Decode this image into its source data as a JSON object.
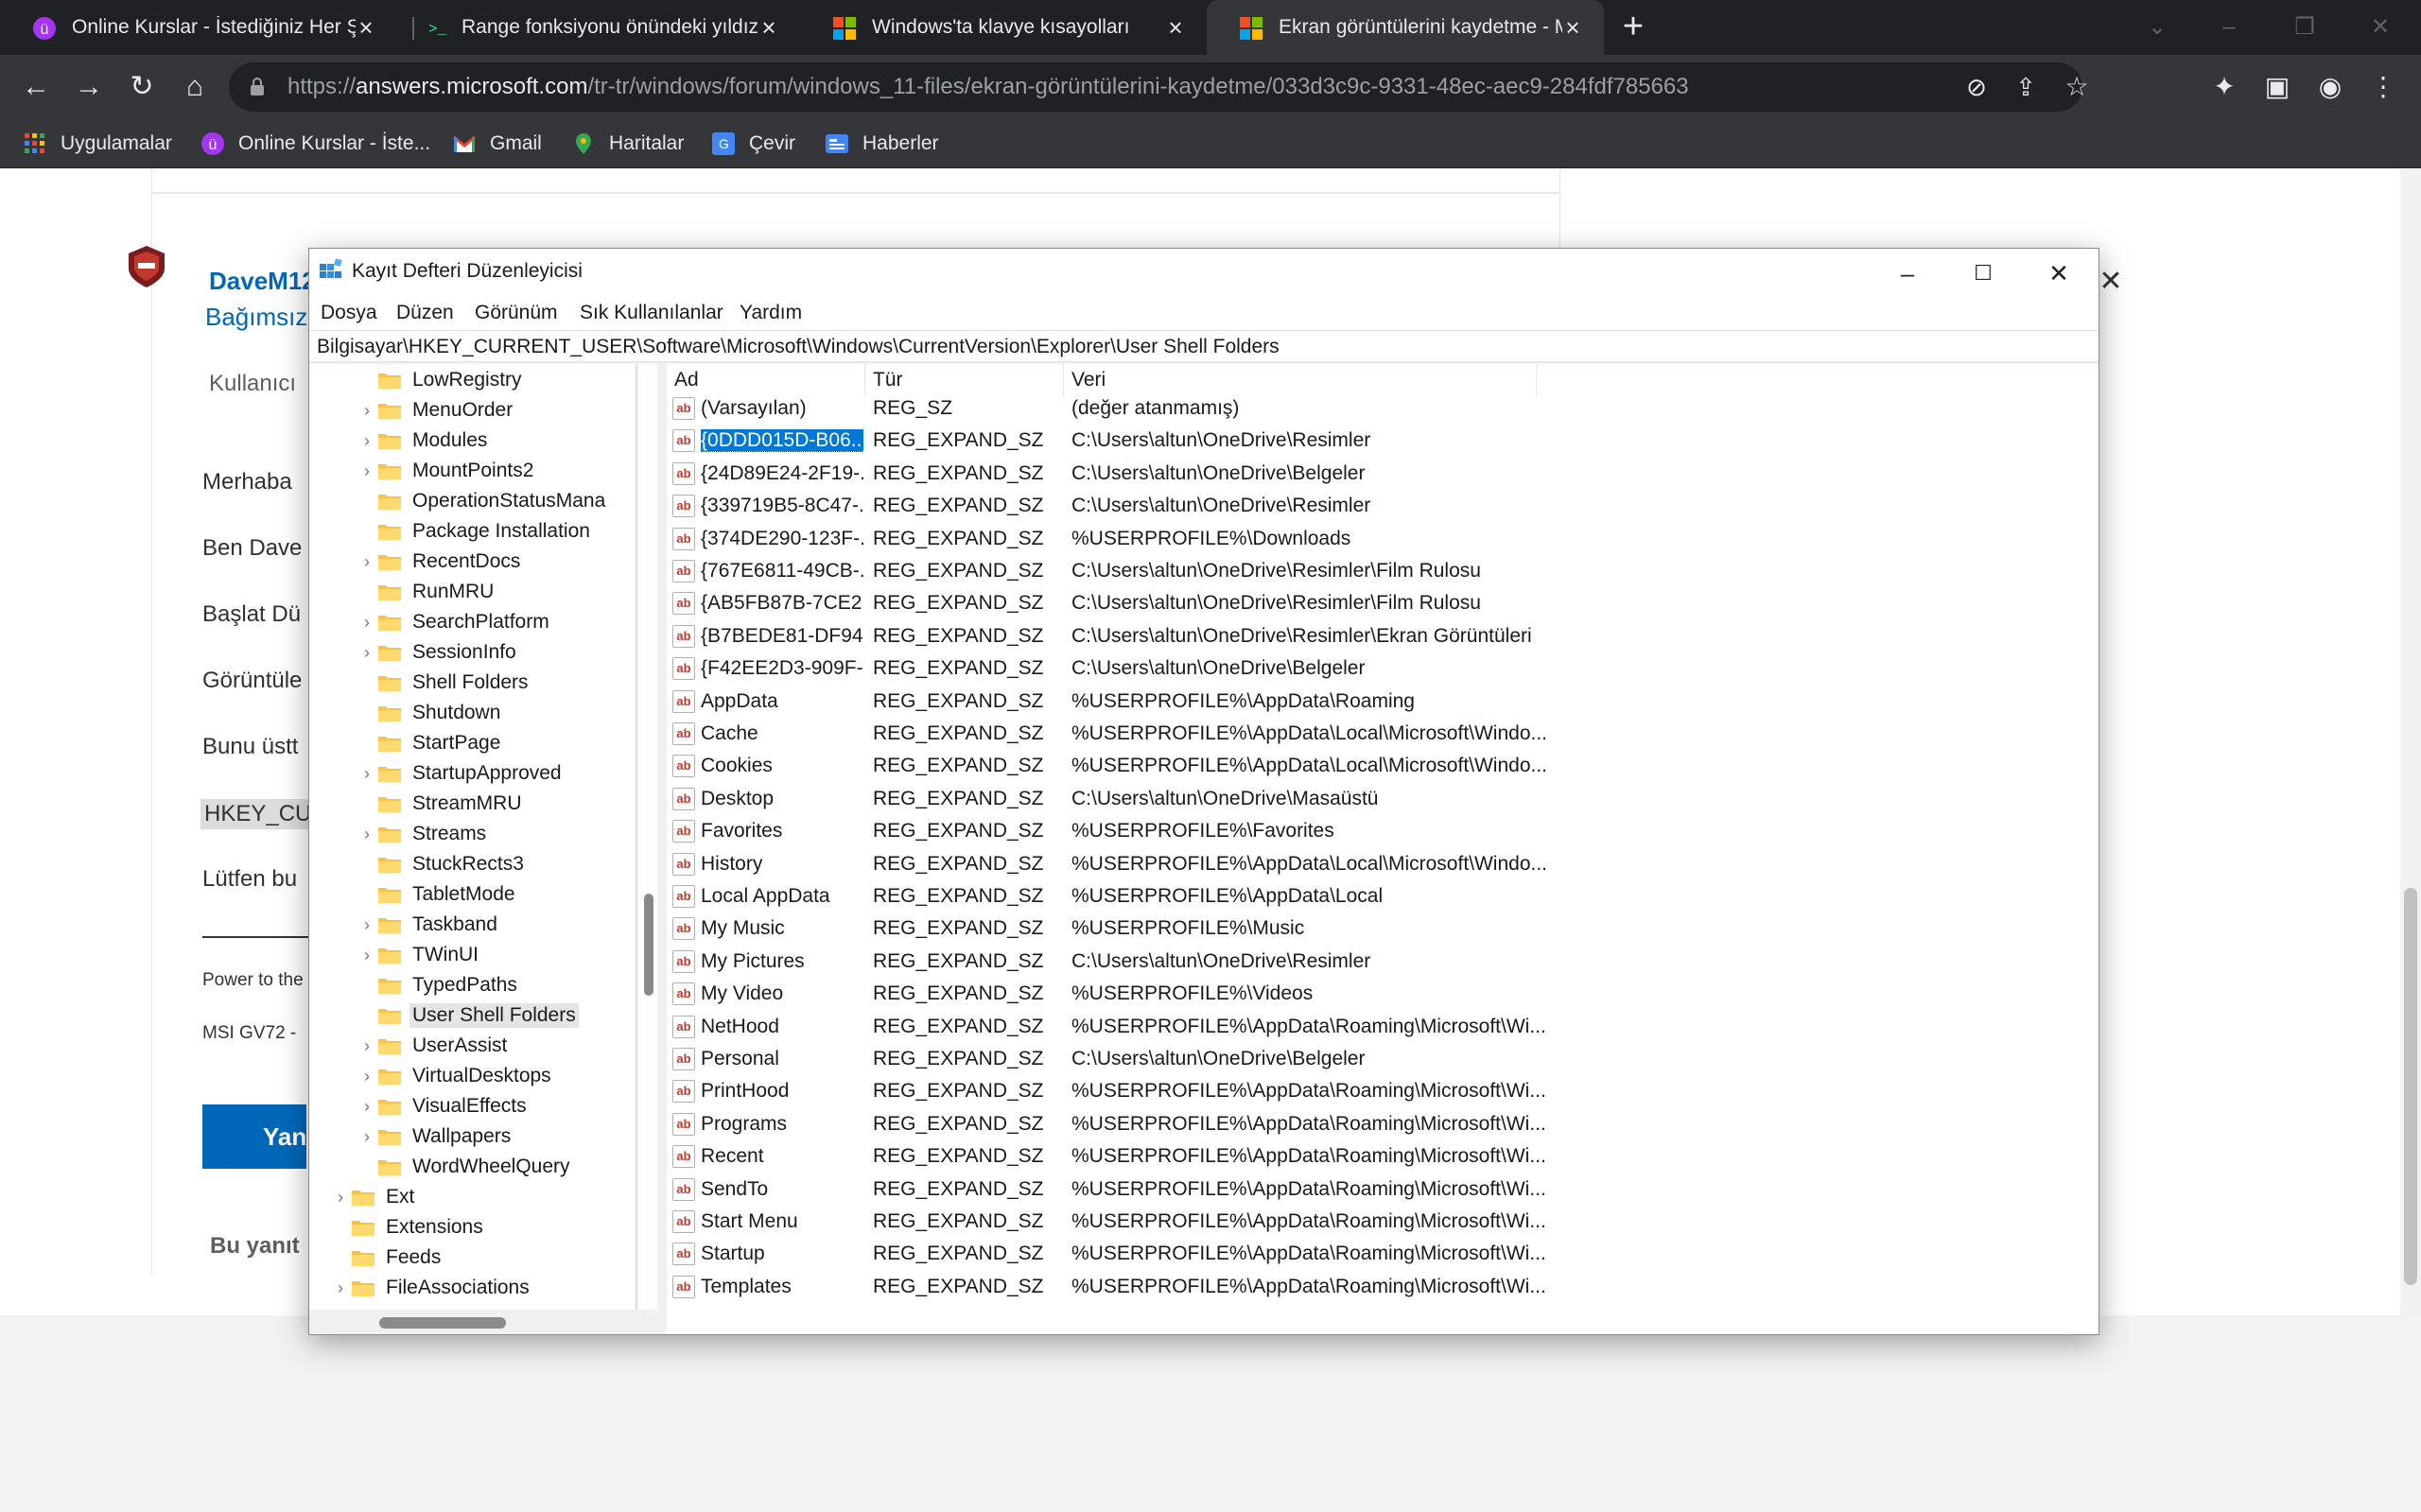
{
  "browser": {
    "tabs": [
      {
        "label": "Online Kurslar - İstediğiniz Her Şey",
        "active": false
      },
      {
        "label": "Range fonksiyonu önündeki yıldız",
        "active": false
      },
      {
        "label": "Windows'ta klavye kısayolları",
        "active": false
      },
      {
        "label": "Ekran görüntülerini kaydetme - M",
        "active": true
      }
    ],
    "new_tab": "+",
    "url_prefix": "https://",
    "url_host": "answers.microsoft.com",
    "url_path": "/tr-tr/windows/forum/windows_11-files/ekran-görüntülerini-kaydetme/033d3c9c-9331-48ec-aec9-284fdf785663",
    "bookmarks": [
      {
        "label": "Uygulamalar"
      },
      {
        "label": "Online Kurslar - İste..."
      },
      {
        "label": "Gmail"
      },
      {
        "label": "Haritalar"
      },
      {
        "label": "Çevir"
      },
      {
        "label": "Haberler"
      }
    ]
  },
  "page": {
    "author_name": "DaveM12",
    "author_role": "Bağımsız",
    "user_label": "Kullanıcı",
    "p1": "Merhaba",
    "p2": "Ben Dave",
    "p3": "Başlat Dü",
    "p4": "Görüntüle",
    "p5": "Bunu üstt",
    "code": "HKEY_CUR",
    "p6": "Lütfen bu",
    "sig1": "Power to the",
    "sig2": "MSI GV72 -",
    "reply_button": "Yanı",
    "footer_text": "Bu yanıt"
  },
  "regedit": {
    "title": "Kayıt Defteri Düzenleyicisi",
    "menu": [
      "Dosya",
      "Düzen",
      "Görünüm",
      "Sık Kullanılanlar",
      "Yardım"
    ],
    "address": "Bilgisayar\\HKEY_CURRENT_USER\\Software\\Microsoft\\Windows\\CurrentVersion\\Explorer\\User Shell Folders",
    "tree": [
      {
        "label": "LowRegistry",
        "level": 2,
        "expander": false
      },
      {
        "label": "MenuOrder",
        "level": 2,
        "expander": true
      },
      {
        "label": "Modules",
        "level": 2,
        "expander": true
      },
      {
        "label": "MountPoints2",
        "level": 2,
        "expander": true
      },
      {
        "label": "OperationStatusMana",
        "level": 2,
        "expander": false
      },
      {
        "label": "Package Installation",
        "level": 2,
        "expander": false
      },
      {
        "label": "RecentDocs",
        "level": 2,
        "expander": true
      },
      {
        "label": "RunMRU",
        "level": 2,
        "expander": false
      },
      {
        "label": "SearchPlatform",
        "level": 2,
        "expander": true
      },
      {
        "label": "SessionInfo",
        "level": 2,
        "expander": true
      },
      {
        "label": "Shell Folders",
        "level": 2,
        "expander": false
      },
      {
        "label": "Shutdown",
        "level": 2,
        "expander": false
      },
      {
        "label": "StartPage",
        "level": 2,
        "expander": false
      },
      {
        "label": "StartupApproved",
        "level": 2,
        "expander": true
      },
      {
        "label": "StreamMRU",
        "level": 2,
        "expander": false
      },
      {
        "label": "Streams",
        "level": 2,
        "expander": true
      },
      {
        "label": "StuckRects3",
        "level": 2,
        "expander": false
      },
      {
        "label": "TabletMode",
        "level": 2,
        "expander": false
      },
      {
        "label": "Taskband",
        "level": 2,
        "expander": true
      },
      {
        "label": "TWinUI",
        "level": 2,
        "expander": true
      },
      {
        "label": "TypedPaths",
        "level": 2,
        "expander": false
      },
      {
        "label": "User Shell Folders",
        "level": 2,
        "expander": false,
        "selected": true
      },
      {
        "label": "UserAssist",
        "level": 2,
        "expander": true
      },
      {
        "label": "VirtualDesktops",
        "level": 2,
        "expander": true
      },
      {
        "label": "VisualEffects",
        "level": 2,
        "expander": true
      },
      {
        "label": "Wallpapers",
        "level": 2,
        "expander": true
      },
      {
        "label": "WordWheelQuery",
        "level": 2,
        "expander": false
      },
      {
        "label": "Ext",
        "level": 1,
        "expander": true
      },
      {
        "label": "Extensions",
        "level": 1,
        "expander": false
      },
      {
        "label": "Feeds",
        "level": 1,
        "expander": false
      },
      {
        "label": "FileAssociations",
        "level": 1,
        "expander": true
      }
    ],
    "columns": [
      "Ad",
      "Tür",
      "Veri"
    ],
    "values": [
      {
        "name": "(Varsayılan)",
        "type": "REG_SZ",
        "data": "(değer atanmamış)"
      },
      {
        "name": "{0DDD015D-B06...",
        "type": "REG_EXPAND_SZ",
        "data": "C:\\Users\\altun\\OneDrive\\Resimler",
        "selected": true
      },
      {
        "name": "{24D89E24-2F19-...",
        "type": "REG_EXPAND_SZ",
        "data": "C:\\Users\\altun\\OneDrive\\Belgeler"
      },
      {
        "name": "{339719B5-8C47-...",
        "type": "REG_EXPAND_SZ",
        "data": "C:\\Users\\altun\\OneDrive\\Resimler"
      },
      {
        "name": "{374DE290-123F-...",
        "type": "REG_EXPAND_SZ",
        "data": "%USERPROFILE%\\Downloads"
      },
      {
        "name": "{767E6811-49CB-...",
        "type": "REG_EXPAND_SZ",
        "data": "C:\\Users\\altun\\OneDrive\\Resimler\\Film Rulosu"
      },
      {
        "name": "{AB5FB87B-7CE2...",
        "type": "REG_EXPAND_SZ",
        "data": "C:\\Users\\altun\\OneDrive\\Resimler\\Film Rulosu"
      },
      {
        "name": "{B7BEDE81-DF94...",
        "type": "REG_EXPAND_SZ",
        "data": "C:\\Users\\altun\\OneDrive\\Resimler\\Ekran Görüntüleri"
      },
      {
        "name": "{F42EE2D3-909F-...",
        "type": "REG_EXPAND_SZ",
        "data": "C:\\Users\\altun\\OneDrive\\Belgeler"
      },
      {
        "name": "AppData",
        "type": "REG_EXPAND_SZ",
        "data": "%USERPROFILE%\\AppData\\Roaming"
      },
      {
        "name": "Cache",
        "type": "REG_EXPAND_SZ",
        "data": "%USERPROFILE%\\AppData\\Local\\Microsoft\\Windo..."
      },
      {
        "name": "Cookies",
        "type": "REG_EXPAND_SZ",
        "data": "%USERPROFILE%\\AppData\\Local\\Microsoft\\Windo..."
      },
      {
        "name": "Desktop",
        "type": "REG_EXPAND_SZ",
        "data": "C:\\Users\\altun\\OneDrive\\Masaüstü"
      },
      {
        "name": "Favorites",
        "type": "REG_EXPAND_SZ",
        "data": "%USERPROFILE%\\Favorites"
      },
      {
        "name": "History",
        "type": "REG_EXPAND_SZ",
        "data": "%USERPROFILE%\\AppData\\Local\\Microsoft\\Windo..."
      },
      {
        "name": "Local AppData",
        "type": "REG_EXPAND_SZ",
        "data": "%USERPROFILE%\\AppData\\Local"
      },
      {
        "name": "My Music",
        "type": "REG_EXPAND_SZ",
        "data": "%USERPROFILE%\\Music"
      },
      {
        "name": "My Pictures",
        "type": "REG_EXPAND_SZ",
        "data": "C:\\Users\\altun\\OneDrive\\Resimler"
      },
      {
        "name": "My Video",
        "type": "REG_EXPAND_SZ",
        "data": "%USERPROFILE%\\Videos"
      },
      {
        "name": "NetHood",
        "type": "REG_EXPAND_SZ",
        "data": "%USERPROFILE%\\AppData\\Roaming\\Microsoft\\Wi..."
      },
      {
        "name": "Personal",
        "type": "REG_EXPAND_SZ",
        "data": "C:\\Users\\altun\\OneDrive\\Belgeler"
      },
      {
        "name": "PrintHood",
        "type": "REG_EXPAND_SZ",
        "data": "%USERPROFILE%\\AppData\\Roaming\\Microsoft\\Wi..."
      },
      {
        "name": "Programs",
        "type": "REG_EXPAND_SZ",
        "data": "%USERPROFILE%\\AppData\\Roaming\\Microsoft\\Wi..."
      },
      {
        "name": "Recent",
        "type": "REG_EXPAND_SZ",
        "data": "%USERPROFILE%\\AppData\\Roaming\\Microsoft\\Wi..."
      },
      {
        "name": "SendTo",
        "type": "REG_EXPAND_SZ",
        "data": "%USERPROFILE%\\AppData\\Roaming\\Microsoft\\Wi..."
      },
      {
        "name": "Start Menu",
        "type": "REG_EXPAND_SZ",
        "data": "%USERPROFILE%\\AppData\\Roaming\\Microsoft\\Wi..."
      },
      {
        "name": "Startup",
        "type": "REG_EXPAND_SZ",
        "data": "%USERPROFILE%\\AppData\\Roaming\\Microsoft\\Wi..."
      },
      {
        "name": "Templates",
        "type": "REG_EXPAND_SZ",
        "data": "%USERPROFILE%\\AppData\\Roaming\\Microsoft\\Wi..."
      }
    ]
  }
}
